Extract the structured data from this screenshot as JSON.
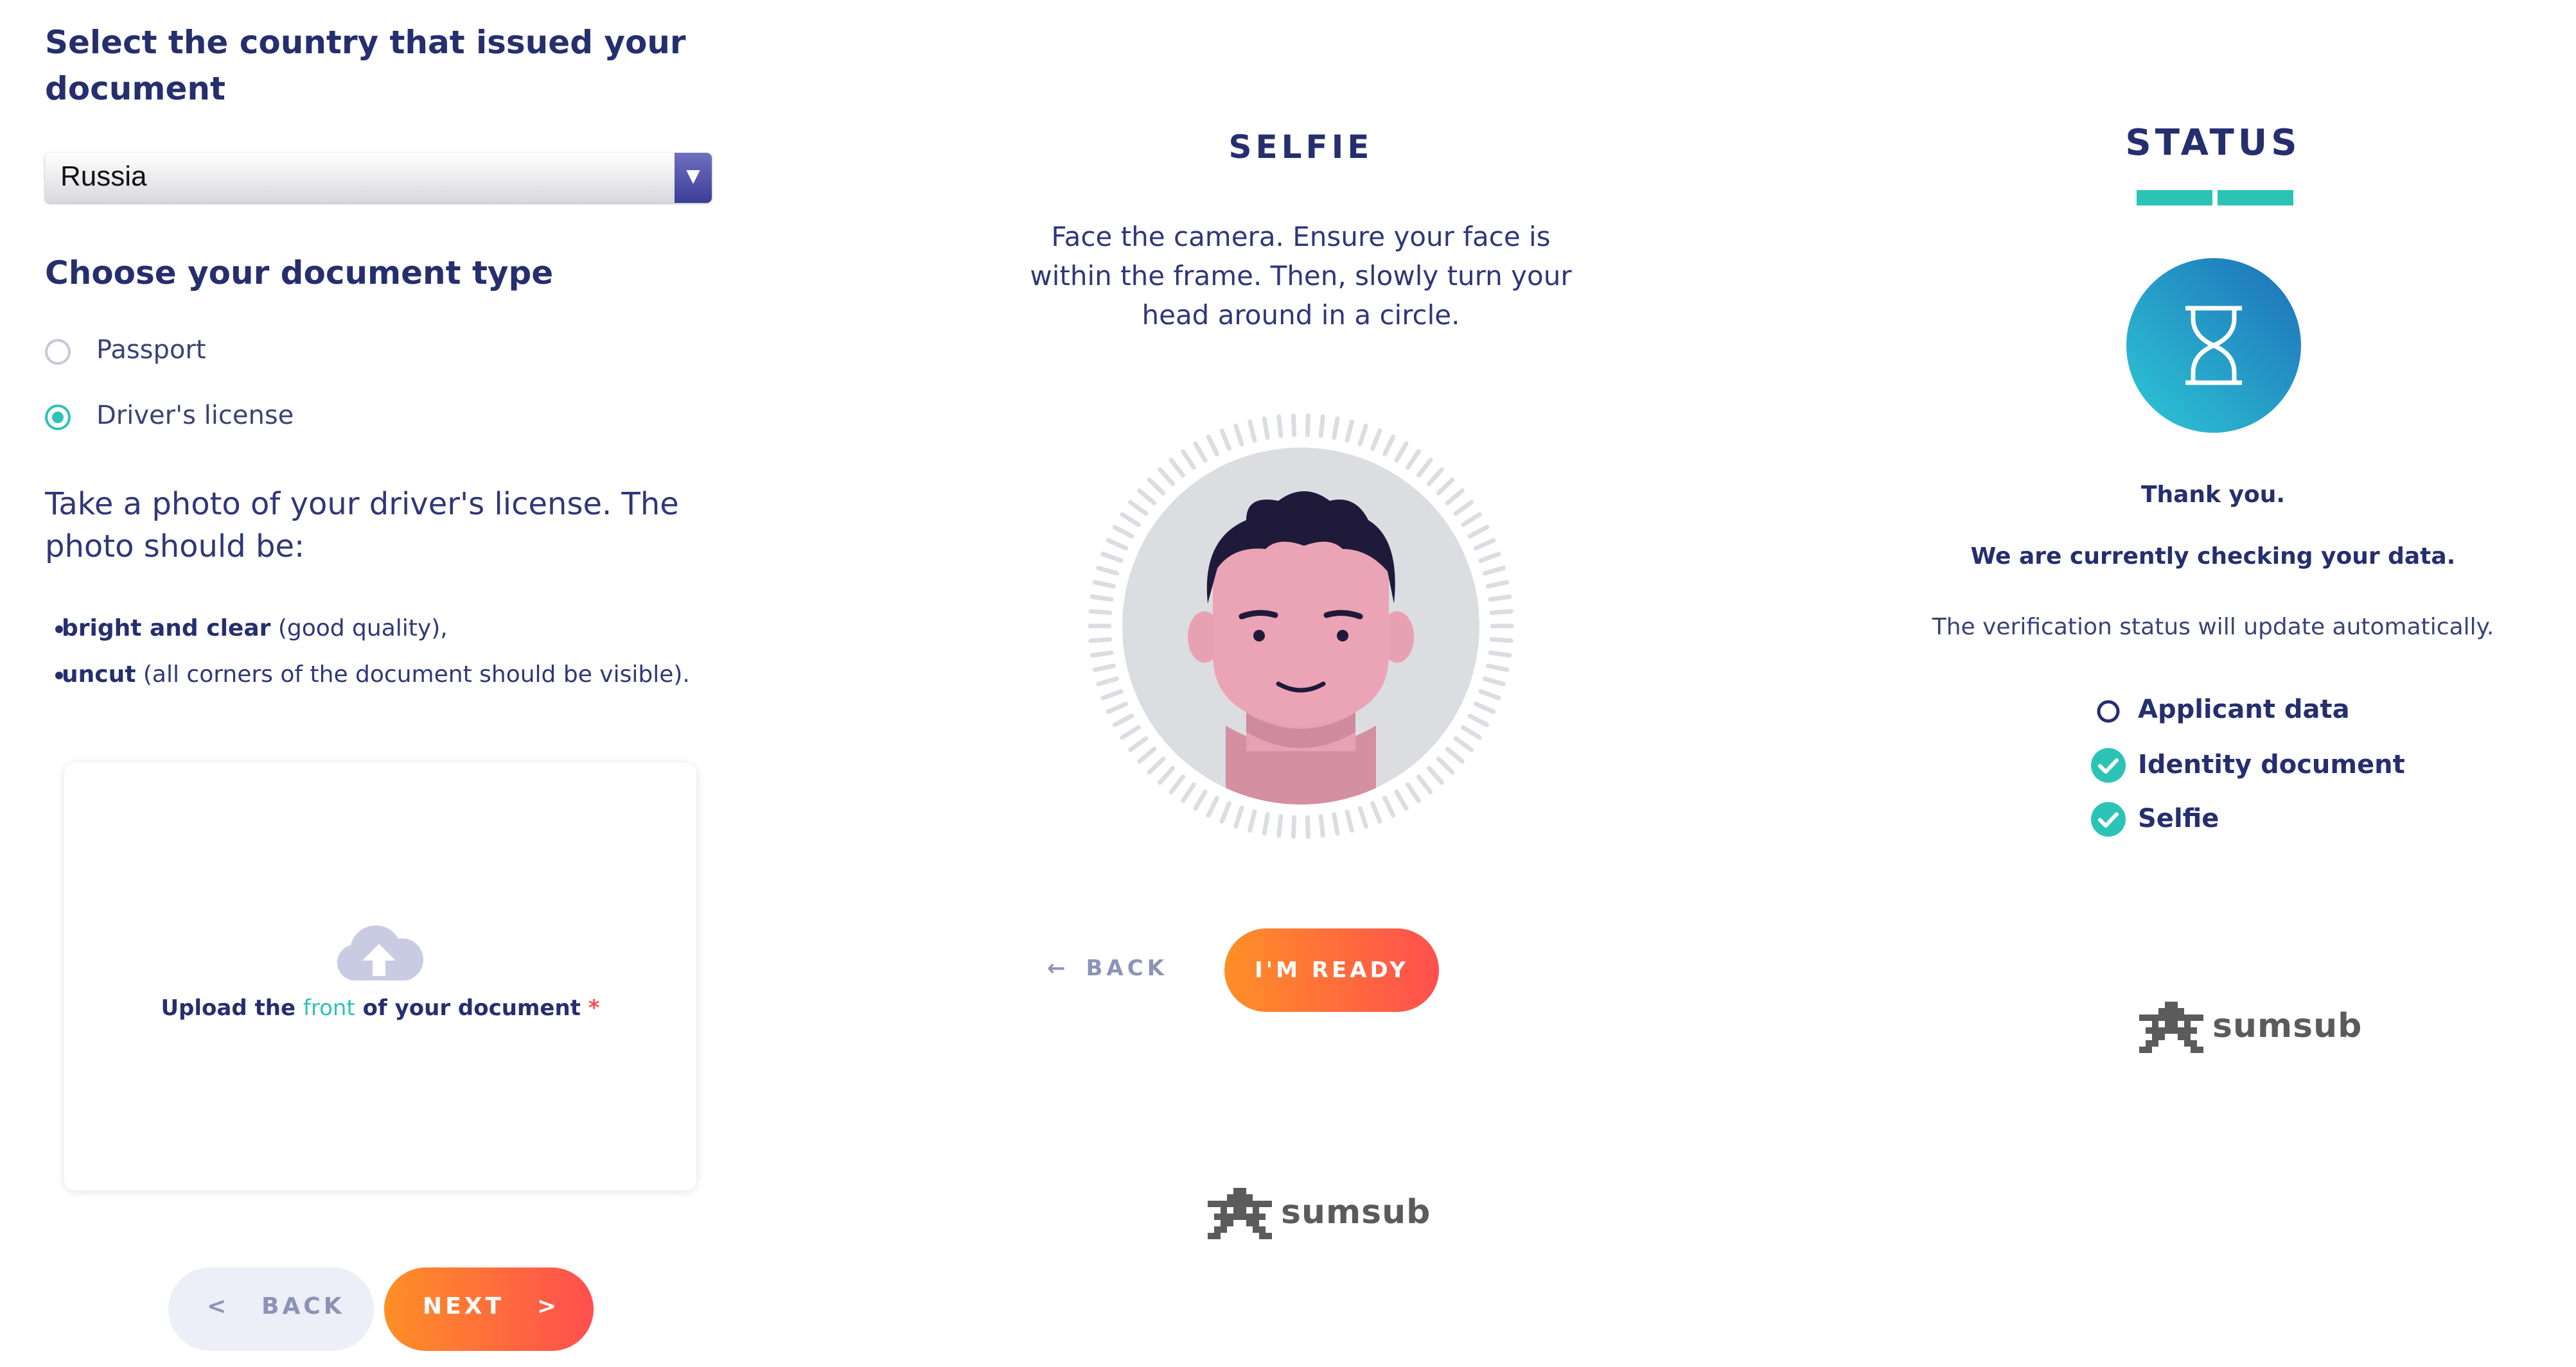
{
  "left": {
    "heading": "Select the country that issued your document",
    "country": {
      "selected": "Russia"
    },
    "doc_type_heading": "Choose your document type",
    "doc_types": [
      {
        "label": "Passport",
        "selected": false
      },
      {
        "label": "Driver's license",
        "selected": true
      }
    ],
    "instructions": "Take a photo of your driver's license. The photo should be:",
    "bullets": [
      {
        "bold": "bright and clear",
        "rest": " (good quality),"
      },
      {
        "bold": "uncut",
        "rest": " (all corners of the document should be visible)."
      }
    ],
    "upload": {
      "prefix": "Upload the ",
      "highlight": "front",
      "suffix": " of your document ",
      "required_mark": "*"
    },
    "back_button": {
      "icon": "<",
      "label": "BACK"
    },
    "next_button": {
      "label": "NEXT",
      "icon": ">"
    }
  },
  "middle": {
    "title": "SELFIE",
    "description": "Face the camera. Ensure your face is within the frame. Then, slowly turn your head around in a circle.",
    "back_label": "BACK",
    "ready_label": "I'M READY",
    "logo_text": "sumsub"
  },
  "right": {
    "title": "STATUS",
    "thank_you": "Thank you.",
    "checking": "We are currently checking your data.",
    "auto_update": "The verification status will update automatically.",
    "steps": [
      {
        "label": "Applicant data",
        "state": "pending"
      },
      {
        "label": "Identity document",
        "state": "done"
      },
      {
        "label": "Selfie",
        "state": "done"
      }
    ],
    "logo_text": "sumsub"
  },
  "colors": {
    "navy": "#252f6e",
    "teal": "#2cc3b7",
    "orange": "#ff8f26",
    "red": "#ff4f4f"
  },
  "icons": {
    "upload": "cloud-upload-icon",
    "hourglass": "hourglass-icon",
    "check": "check-circle-icon",
    "pending": "empty-circle-icon"
  }
}
